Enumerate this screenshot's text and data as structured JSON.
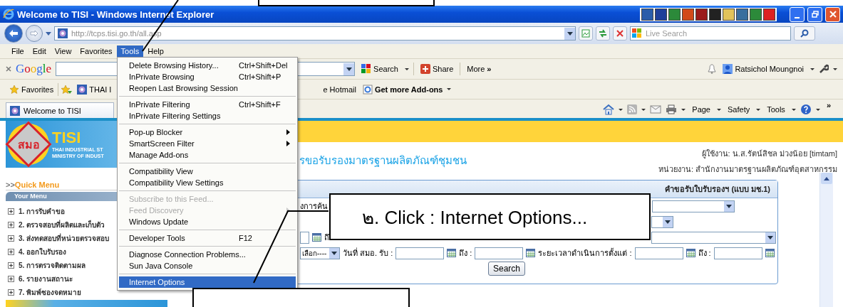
{
  "window": {
    "title": "Welcome to TISI - Windows Internet Explorer"
  },
  "address_bar": {
    "url": "http://tcps.tisi.go.th/all.asp"
  },
  "search_box": {
    "placeholder": "Live Search"
  },
  "menu_bar": [
    {
      "label": "File",
      "selected": false
    },
    {
      "label": "Edit",
      "selected": false
    },
    {
      "label": "View",
      "selected": false
    },
    {
      "label": "Favorites",
      "selected": false
    },
    {
      "label": "Tools",
      "selected": true
    },
    {
      "label": "Help",
      "selected": false
    }
  ],
  "google_toolbar": {
    "logo": "Google",
    "search_button": "Search",
    "share_button": "Share",
    "more_button": "More",
    "more_mark": "»",
    "user_name": "Ratsichol Moungnoi"
  },
  "favorites_bar": {
    "favorites": "Favorites",
    "links": [
      "THAI I",
      "e Hotmail"
    ],
    "addons": "Get more Add-ons"
  },
  "tab": {
    "title": "Welcome to TISI"
  },
  "command_bar": {
    "buttons": [
      "Page",
      "Safety",
      "Tools"
    ],
    "overflow": "»"
  },
  "tools_menu": [
    {
      "kind": "item",
      "label": "Delete Browsing History...",
      "shortcut": "Ctrl+Shift+Del",
      "submenu": false,
      "disabled": false,
      "selected": false
    },
    {
      "kind": "item",
      "label": "InPrivate Browsing",
      "shortcut": "Ctrl+Shift+P",
      "submenu": false,
      "disabled": false,
      "selected": false
    },
    {
      "kind": "item",
      "label": "Reopen Last Browsing Session",
      "submenu": false,
      "disabled": false,
      "selected": false
    },
    {
      "kind": "separator"
    },
    {
      "kind": "item",
      "label": "InPrivate Filtering",
      "shortcut": "Ctrl+Shift+F",
      "submenu": false,
      "disabled": false,
      "selected": false
    },
    {
      "kind": "item",
      "label": "InPrivate Filtering Settings",
      "submenu": false,
      "disabled": false,
      "selected": false
    },
    {
      "kind": "separator"
    },
    {
      "kind": "item",
      "label": "Pop-up Blocker",
      "submenu": true,
      "disabled": false,
      "selected": false
    },
    {
      "kind": "item",
      "label": "SmartScreen Filter",
      "submenu": true,
      "disabled": false,
      "selected": false
    },
    {
      "kind": "item",
      "label": "Manage Add-ons",
      "submenu": false,
      "disabled": false,
      "selected": false
    },
    {
      "kind": "separator"
    },
    {
      "kind": "item",
      "label": "Compatibility View",
      "submenu": false,
      "disabled": false,
      "selected": false
    },
    {
      "kind": "item",
      "label": "Compatibility View Settings",
      "submenu": false,
      "disabled": false,
      "selected": false
    },
    {
      "kind": "separator"
    },
    {
      "kind": "item",
      "label": "Subscribe to this Feed...",
      "submenu": false,
      "disabled": true,
      "selected": false
    },
    {
      "kind": "item",
      "label": "Feed Discovery",
      "submenu": true,
      "disabled": true,
      "selected": false
    },
    {
      "kind": "item",
      "label": "Windows Update",
      "submenu": false,
      "disabled": false,
      "selected": false
    },
    {
      "kind": "separator"
    },
    {
      "kind": "item",
      "label": "Developer Tools",
      "shortcut": "F12",
      "submenu": false,
      "disabled": false,
      "selected": false
    },
    {
      "kind": "separator"
    },
    {
      "kind": "item",
      "label": "Diagnose Connection Problems...",
      "submenu": false,
      "disabled": false,
      "selected": false
    },
    {
      "kind": "item",
      "label": "Sun Java Console",
      "submenu": false,
      "disabled": false,
      "selected": false
    },
    {
      "kind": "separator"
    },
    {
      "kind": "item",
      "label": "Internet Options",
      "submenu": false,
      "disabled": false,
      "selected": true
    }
  ],
  "page": {
    "logo": {
      "emblem": "สมอ",
      "name": "TISI",
      "line_1": "THAI INDUSTRIAL ST",
      "line_2": "MINISTRY OF INDUST"
    },
    "quick_menu": {
      "prefix": ">>",
      "label": "Quick Menu"
    },
    "your_menu": "Your Menu",
    "sidebar_items": [
      {
        "label": "1. การรับคำขอ",
        "expanded": false
      },
      {
        "label": "2. ตรวจสอบที่ผลิตและเก็บตัว",
        "expanded": false
      },
      {
        "label": "3. ส่งทดสอบที่หน่วยตรวจสอบ",
        "expanded": false
      },
      {
        "label": "4. ออกใบรับรอง",
        "expanded": false
      },
      {
        "label": "5. การตรวจติดตามผล",
        "expanded": false
      },
      {
        "label": "6. รายงานสถานะ",
        "expanded": false
      },
      {
        "label": "7. พิมพ์ซองจดหมาย",
        "expanded": false
      }
    ],
    "title": "รขอรับรองมาตรฐานผลิตภัณฑ์ชุมชน",
    "user_line": "ผู้ใช้งาน: น.ส.รัตน์สิชล ม่วงน้อย [timtam]",
    "unit_line": "หน่วยงาน: สำนักงานมาตรฐานผลิตภัณฑ์อุตสาหกรรม",
    "panel": {
      "title": "คำขอรับใบรับรองฯ (แบบ มช.1)",
      "row_1_label": "งการค้น",
      "row_3_label": "ถึ",
      "status_select": "เลือก----",
      "received_date_label": "วันที่ สมอ. รับ :",
      "received_to_label": "ถึง :",
      "duration_label": "ระยะเวลาดำเนินการตั้งแต่ :",
      "duration_to_label": "ถึง :",
      "search_button": "Search"
    }
  },
  "callouts": [
    {
      "kind": "empty"
    },
    {
      "kind": "text",
      "text": "๒. Click : Internet Options..."
    },
    {
      "kind": "empty"
    }
  ]
}
